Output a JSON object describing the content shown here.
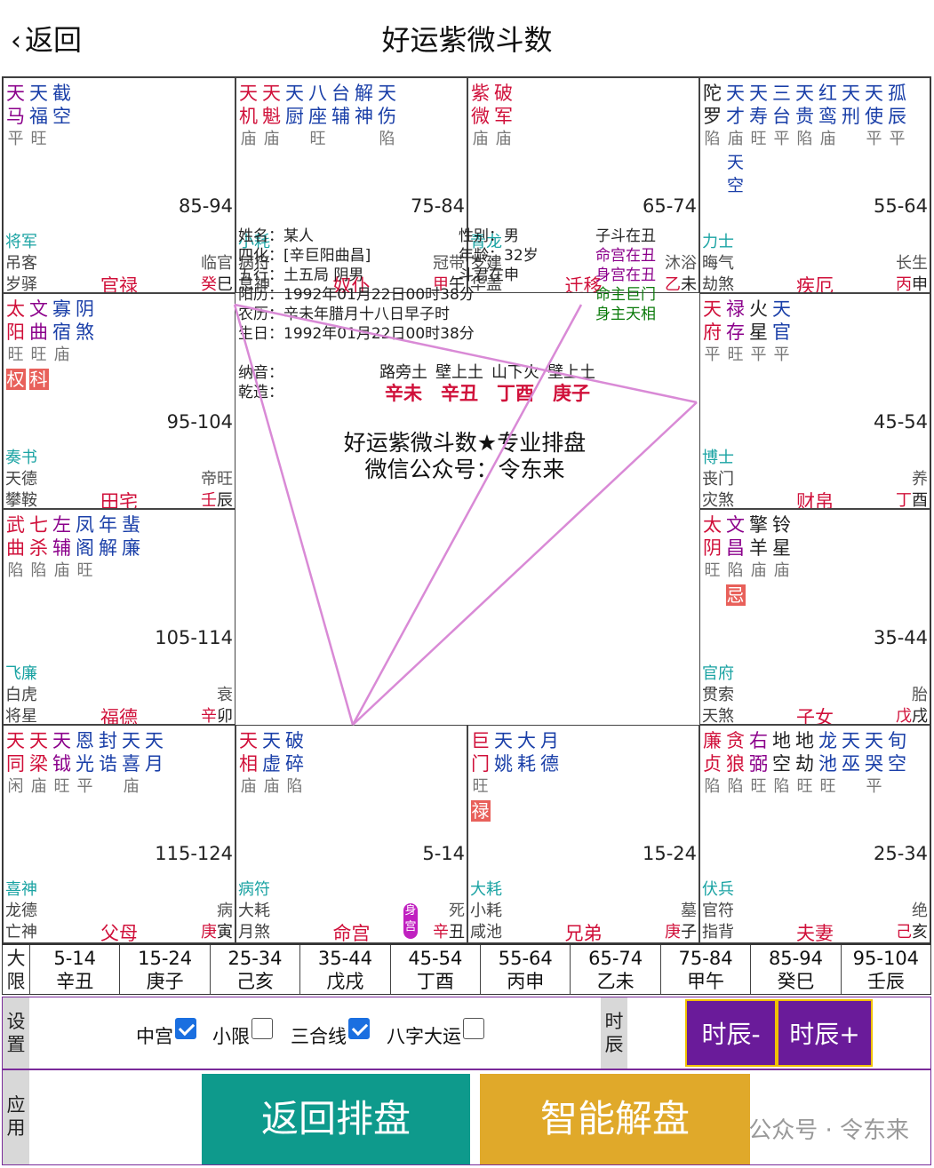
{
  "header": {
    "back_icon": "chevron-left-icon",
    "back_label": "返回",
    "title": "好运紫微斗数"
  },
  "cells": [
    {
      "id": "si",
      "stars": [
        {
          "n": "天马",
          "b": "平",
          "c": "pur"
        },
        {
          "n": "天福",
          "b": "旺",
          "c": "blue"
        },
        {
          "n": "截空",
          "b": "",
          "c": "blue"
        }
      ],
      "range": "85-94",
      "g1": "将军",
      "g2": "吊客",
      "g3": "岁驿",
      "stage": "临官",
      "palace": "官禄",
      "gz_s": "癸",
      "gz_b": "巳"
    },
    {
      "id": "wu",
      "stars": [
        {
          "n": "天机",
          "b": "庙",
          "c": "red"
        },
        {
          "n": "天魁",
          "b": "庙",
          "c": "red"
        },
        {
          "n": "天厨",
          "b": "",
          "c": "blue"
        },
        {
          "n": "八座",
          "b": "旺",
          "c": "blue"
        },
        {
          "n": "台辅",
          "b": "",
          "c": "blue"
        },
        {
          "n": "解神",
          "b": "",
          "c": "blue"
        },
        {
          "n": "天伤",
          "b": "陷",
          "c": "blue"
        }
      ],
      "range": "75-84",
      "g1": "小耗",
      "g2": "病符",
      "g3": "息神",
      "stage": "冠带",
      "palace": "奴仆",
      "gz_s": "甲",
      "gz_b": "午"
    },
    {
      "id": "wei",
      "stars": [
        {
          "n": "紫微",
          "b": "庙",
          "c": "red"
        },
        {
          "n": "破军",
          "b": "庙",
          "c": "red"
        }
      ],
      "range": "65-74",
      "g1": "青龙",
      "g2": "岁建",
      "g3": "华盖",
      "stage": "沐浴",
      "palace": "迁移",
      "gz_s": "乙",
      "gz_b": "未"
    },
    {
      "id": "shen",
      "stars": [
        {
          "n": "陀罗",
          "b": "陷",
          "c": "dark"
        },
        {
          "n": "天才",
          "b": "庙",
          "c": "blue",
          "extra": "天空"
        },
        {
          "n": "天寿",
          "b": "旺",
          "c": "blue"
        },
        {
          "n": "三台",
          "b": "平",
          "c": "blue"
        },
        {
          "n": "天贵",
          "b": "陷",
          "c": "blue"
        },
        {
          "n": "红鸾",
          "b": "庙",
          "c": "blue"
        },
        {
          "n": "天刑",
          "b": "",
          "c": "blue"
        },
        {
          "n": "天使",
          "b": "平",
          "c": "blue"
        },
        {
          "n": "孤辰",
          "b": "平",
          "c": "blue"
        }
      ],
      "range": "55-64",
      "g1": "力士",
      "g2": "晦气",
      "g3": "劫煞",
      "stage": "长生",
      "palace": "疾厄",
      "gz_s": "丙",
      "gz_b": "申"
    },
    {
      "id": "chen",
      "stars": [
        {
          "n": "太阳",
          "b": "旺",
          "c": "red",
          "hua": "权"
        },
        {
          "n": "文曲",
          "b": "旺",
          "c": "pur",
          "hua": "科"
        },
        {
          "n": "寡宿",
          "b": "庙",
          "c": "blue"
        },
        {
          "n": "阴煞",
          "b": "",
          "c": "blue"
        }
      ],
      "range": "95-104",
      "g1": "奏书",
      "g2": "天德",
      "g3": "攀鞍",
      "stage": "帝旺",
      "palace": "田宅",
      "gz_s": "壬",
      "gz_b": "辰"
    },
    {
      "id": "you",
      "stars": [
        {
          "n": "天府",
          "b": "平",
          "c": "red"
        },
        {
          "n": "禄存",
          "b": "旺",
          "c": "pur"
        },
        {
          "n": "火星",
          "b": "平",
          "c": "dark"
        },
        {
          "n": "天官",
          "b": "平",
          "c": "blue"
        }
      ],
      "range": "45-54",
      "g1": "博士",
      "g2": "丧门",
      "g3": "灾煞",
      "stage": "养",
      "palace": "财帛",
      "gz_s": "丁",
      "gz_b": "酉"
    },
    {
      "id": "mao",
      "stars": [
        {
          "n": "武曲",
          "b": "陷",
          "c": "red"
        },
        {
          "n": "七杀",
          "b": "陷",
          "c": "red"
        },
        {
          "n": "左辅",
          "b": "庙",
          "c": "pur"
        },
        {
          "n": "凤阁",
          "b": "旺",
          "c": "blue"
        },
        {
          "n": "年解",
          "b": "",
          "c": "blue"
        },
        {
          "n": "蜚廉",
          "b": "",
          "c": "blue"
        }
      ],
      "range": "105-114",
      "g1": "飞廉",
      "g2": "白虎",
      "g3": "将星",
      "stage": "衰",
      "palace": "福德",
      "gz_s": "辛",
      "gz_b": "卯"
    },
    {
      "id": "xu",
      "stars": [
        {
          "n": "太阴",
          "b": "旺",
          "c": "red"
        },
        {
          "n": "文昌",
          "b": "陷",
          "c": "pur",
          "hua": "忌"
        },
        {
          "n": "擎羊",
          "b": "庙",
          "c": "dark"
        },
        {
          "n": "铃星",
          "b": "庙",
          "c": "dark"
        }
      ],
      "range": "35-44",
      "g1": "官府",
      "g2": "贯索",
      "g3": "天煞",
      "stage": "胎",
      "palace": "子女",
      "gz_s": "戊",
      "gz_b": "戌"
    },
    {
      "id": "yin",
      "stars": [
        {
          "n": "天同",
          "b": "闲",
          "c": "red"
        },
        {
          "n": "天梁",
          "b": "庙",
          "c": "red"
        },
        {
          "n": "天钺",
          "b": "旺",
          "c": "pur"
        },
        {
          "n": "恩光",
          "b": "平",
          "c": "blue"
        },
        {
          "n": "封诰",
          "b": "",
          "c": "blue"
        },
        {
          "n": "天喜",
          "b": "庙",
          "c": "blue"
        },
        {
          "n": "天月",
          "b": "",
          "c": "blue"
        }
      ],
      "range": "115-124",
      "g1": "喜神",
      "g2": "龙德",
      "g3": "亡神",
      "stage": "病",
      "palace": "父母",
      "gz_s": "庚",
      "gz_b": "寅"
    },
    {
      "id": "chou",
      "stars": [
        {
          "n": "天相",
          "b": "庙",
          "c": "red"
        },
        {
          "n": "天虚",
          "b": "庙",
          "c": "blue"
        },
        {
          "n": "破碎",
          "b": "陷",
          "c": "blue"
        }
      ],
      "range": "5-14",
      "g1": "病符",
      "g2": "大耗",
      "g3": "月煞",
      "stage": "死",
      "palace": "命宫",
      "gz_s": "辛",
      "gz_b": "丑",
      "shen": "身宫"
    },
    {
      "id": "zi",
      "stars": [
        {
          "n": "巨门",
          "b": "旺",
          "c": "red",
          "hua": "禄"
        },
        {
          "n": "天姚",
          "b": "",
          "c": "blue"
        },
        {
          "n": "大耗",
          "b": "",
          "c": "blue"
        },
        {
          "n": "月德",
          "b": "",
          "c": "blue"
        }
      ],
      "range": "15-24",
      "g1": "大耗",
      "g2": "小耗",
      "g3": "咸池",
      "stage": "墓",
      "palace": "兄弟",
      "gz_s": "庚",
      "gz_b": "子"
    },
    {
      "id": "hai",
      "stars": [
        {
          "n": "廉贞",
          "b": "陷",
          "c": "red"
        },
        {
          "n": "贪狼",
          "b": "陷",
          "c": "red"
        },
        {
          "n": "右弼",
          "b": "旺",
          "c": "pur"
        },
        {
          "n": "地空",
          "b": "陷",
          "c": "dark"
        },
        {
          "n": "地劫",
          "b": "旺",
          "c": "dark"
        },
        {
          "n": "龙池",
          "b": "旺",
          "c": "blue"
        },
        {
          "n": "天巫",
          "b": "",
          "c": "blue"
        },
        {
          "n": "天哭",
          "b": "平",
          "c": "blue"
        },
        {
          "n": "旬空",
          "b": "",
          "c": "blue"
        }
      ],
      "range": "25-34",
      "g1": "伏兵",
      "g2": "官符",
      "g3": "指背",
      "stage": "绝",
      "palace": "夫妻",
      "gz_s": "己",
      "gz_b": "亥"
    }
  ],
  "center": {
    "left": [
      "姓名：某人",
      "四化：[辛巨阳曲昌]",
      "五行：土五局 阴男",
      "阳历：1992年01月22日00时38分",
      "农历：辛未年腊月十八日早子时",
      "生日：1992年01月22日00时38分"
    ],
    "mid": [
      "性别：男",
      "年龄：32岁",
      "斗君在申"
    ],
    "right": [
      {
        "t": "子斗在丑",
        "c": "#222"
      },
      {
        "t": "命宫在丑",
        "c": "#8b008b"
      },
      {
        "t": "身宫在丑",
        "c": "#8b008b"
      },
      {
        "t": "命主巨门",
        "c": "#0a7a0a"
      },
      {
        "t": "身主天相",
        "c": "#0a7a0a"
      }
    ],
    "nayin_label": "纳音：",
    "qianzao_label": "乾造：",
    "nayin": [
      "路旁土",
      "壁上土",
      "山下火",
      "壁上土"
    ],
    "bazi": [
      "辛未",
      "辛丑",
      "丁酉",
      "庚子"
    ],
    "brand1": "好运紫微斗数★专业排盘",
    "brand2": "微信公众号：令东来"
  },
  "dayun": {
    "label": "大限",
    "items": [
      [
        "5-14",
        "辛丑"
      ],
      [
        "15-24",
        "庚子"
      ],
      [
        "25-34",
        "己亥"
      ],
      [
        "35-44",
        "戊戌"
      ],
      [
        "45-54",
        "丁酉"
      ],
      [
        "55-64",
        "丙申"
      ],
      [
        "65-74",
        "乙未"
      ],
      [
        "75-84",
        "甲午"
      ],
      [
        "85-94",
        "癸巳"
      ],
      [
        "95-104",
        "壬辰"
      ]
    ]
  },
  "settings": {
    "label": "设置",
    "options": [
      {
        "label": "中宫",
        "checked": true
      },
      {
        "label": "小限",
        "checked": false
      },
      {
        "label": "三合线",
        "checked": true
      },
      {
        "label": "八字大运",
        "checked": false
      }
    ],
    "time_label": "时辰",
    "btn_minus": "时辰-",
    "btn_plus": "时辰+"
  },
  "app": {
    "label": "应用",
    "btn_back": "返回排盘",
    "btn_ai": "智能解盘",
    "watermark": "公众号 · 令东来"
  },
  "colors": {
    "red": "#d0103a",
    "purple": "#8b008b",
    "blue": "#1a3fa8",
    "teal": "#1aa3a3",
    "btn_teal": "#0e9a8c",
    "btn_gold": "#e0a92a",
    "btn_purple": "#6a1b9a",
    "line": "#d98ad6"
  }
}
